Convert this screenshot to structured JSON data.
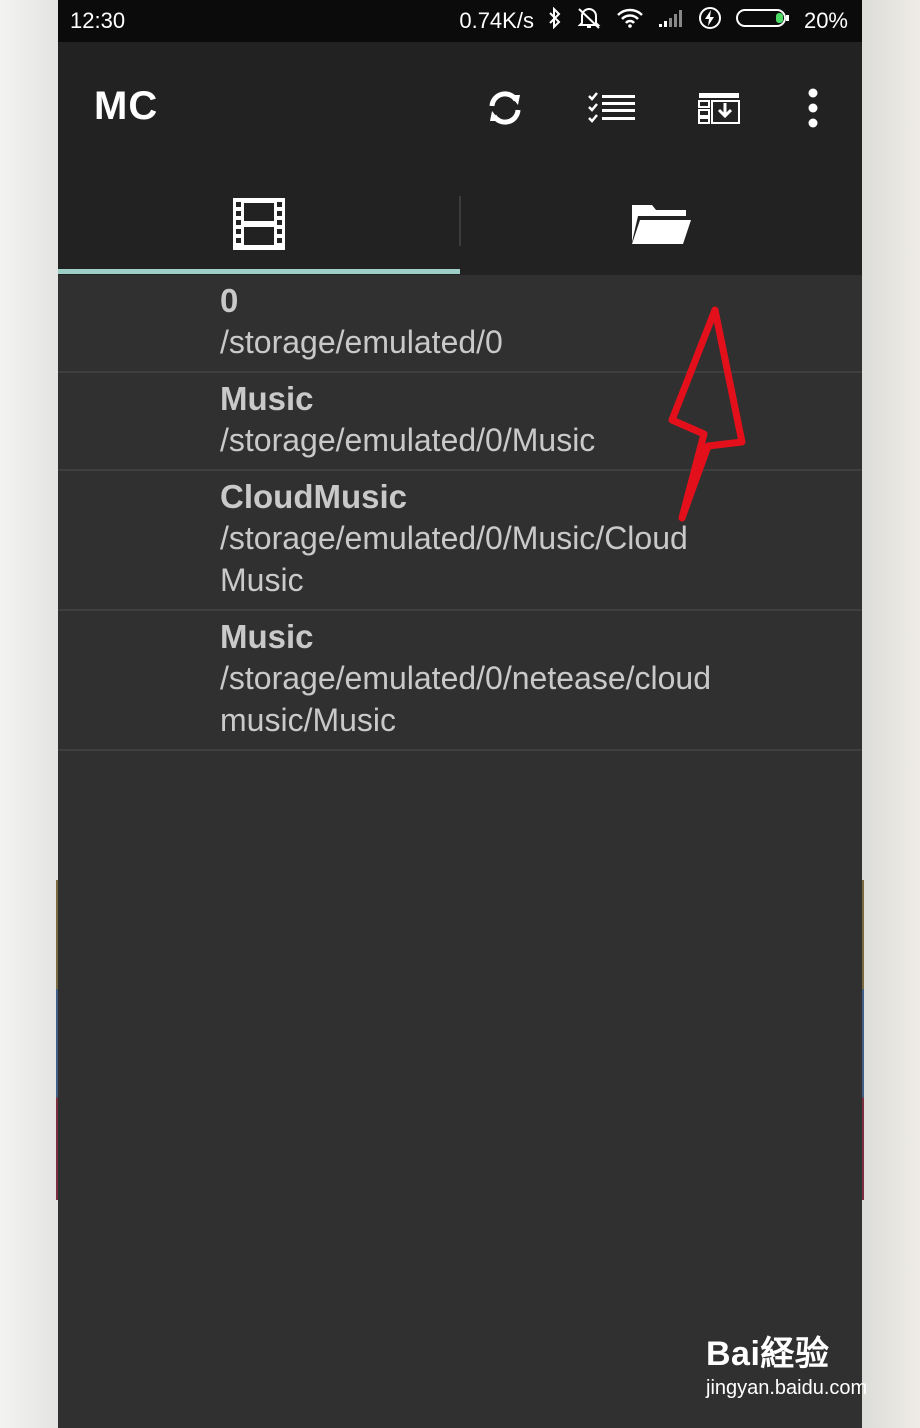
{
  "status_bar": {
    "time": "12:30",
    "net_speed": "0.74K/s",
    "battery": "20%",
    "icons": [
      "bluetooth-icon",
      "silent-alarm-icon",
      "wifi-icon",
      "signal-icon",
      "charging-icon",
      "battery-icon"
    ]
  },
  "app_bar": {
    "title": "MC",
    "actions": [
      "refresh-icon",
      "checklist-icon",
      "playlist-download-icon",
      "overflow-menu-icon"
    ]
  },
  "tabs": [
    {
      "icon": "film-icon",
      "selected": true
    },
    {
      "icon": "folder-open-icon",
      "selected": false
    }
  ],
  "folders": [
    {
      "name": "0",
      "path": "/storage/emulated/0"
    },
    {
      "name": "Music",
      "path": "/storage/emulated/0/Music"
    },
    {
      "name": "CloudMusic",
      "path": "/storage/emulated/0/Music/CloudMusic"
    },
    {
      "name": "Music",
      "path": "/storage/emulated/0/netease/cloudmusic/Music"
    }
  ],
  "watermark": {
    "brand": "Bai経验",
    "url": "jingyan.baidu.com"
  },
  "colors": {
    "accent": "#9dcfc7",
    "app_bar": "#222222",
    "background": "#303030",
    "arrow": "#e3101c"
  }
}
